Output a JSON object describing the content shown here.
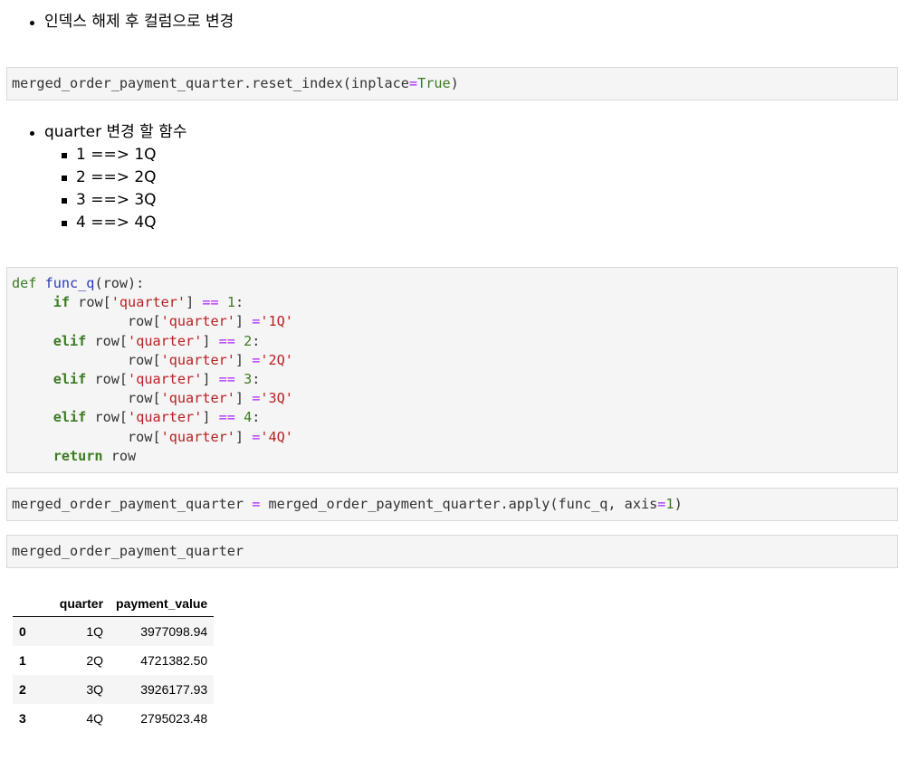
{
  "markdown1": {
    "bullet": "인덱스 해제 후 컬럼으로 변경"
  },
  "cell1": {
    "obj": "merged_order_payment_quarter",
    "method": ".reset_index(",
    "kwarg": "inplace",
    "eq": "=",
    "val": "True",
    "close": ")"
  },
  "markdown2": {
    "bullet": "quarter 변경 할 함수",
    "sub_items": [
      "1 ==> 1Q",
      "2 ==> 2Q",
      "3 ==> 3Q",
      "4 ==> 4Q"
    ]
  },
  "cell2": {
    "def": "def",
    "fname": "func_q",
    "sig": "(row):",
    "if": "if",
    "elif": "elif",
    "return": "return",
    "row": "row",
    "key": "'quarter'",
    "eqeq": "==",
    "assign": "=",
    "conds": [
      "1",
      "2",
      "3",
      "4"
    ],
    "vals": [
      "'1Q'",
      "'2Q'",
      "'3Q'",
      "'4Q'"
    ]
  },
  "cell3": {
    "lhs": "merged_order_payment_quarter",
    "eq": "=",
    "rhs": "merged_order_payment_quarter.apply(func_q, axis",
    "eq2": "=",
    "num": "1",
    "close": ")"
  },
  "cell4": {
    "code": "merged_order_payment_quarter"
  },
  "dataframe": {
    "columns": [
      "quarter",
      "payment_value"
    ],
    "rows": [
      {
        "index": "0",
        "quarter": "1Q",
        "payment_value": "3977098.94"
      },
      {
        "index": "1",
        "quarter": "2Q",
        "payment_value": "4721382.50"
      },
      {
        "index": "2",
        "quarter": "3Q",
        "payment_value": "3926177.93"
      },
      {
        "index": "3",
        "quarter": "4Q",
        "payment_value": "2795023.48"
      }
    ]
  }
}
